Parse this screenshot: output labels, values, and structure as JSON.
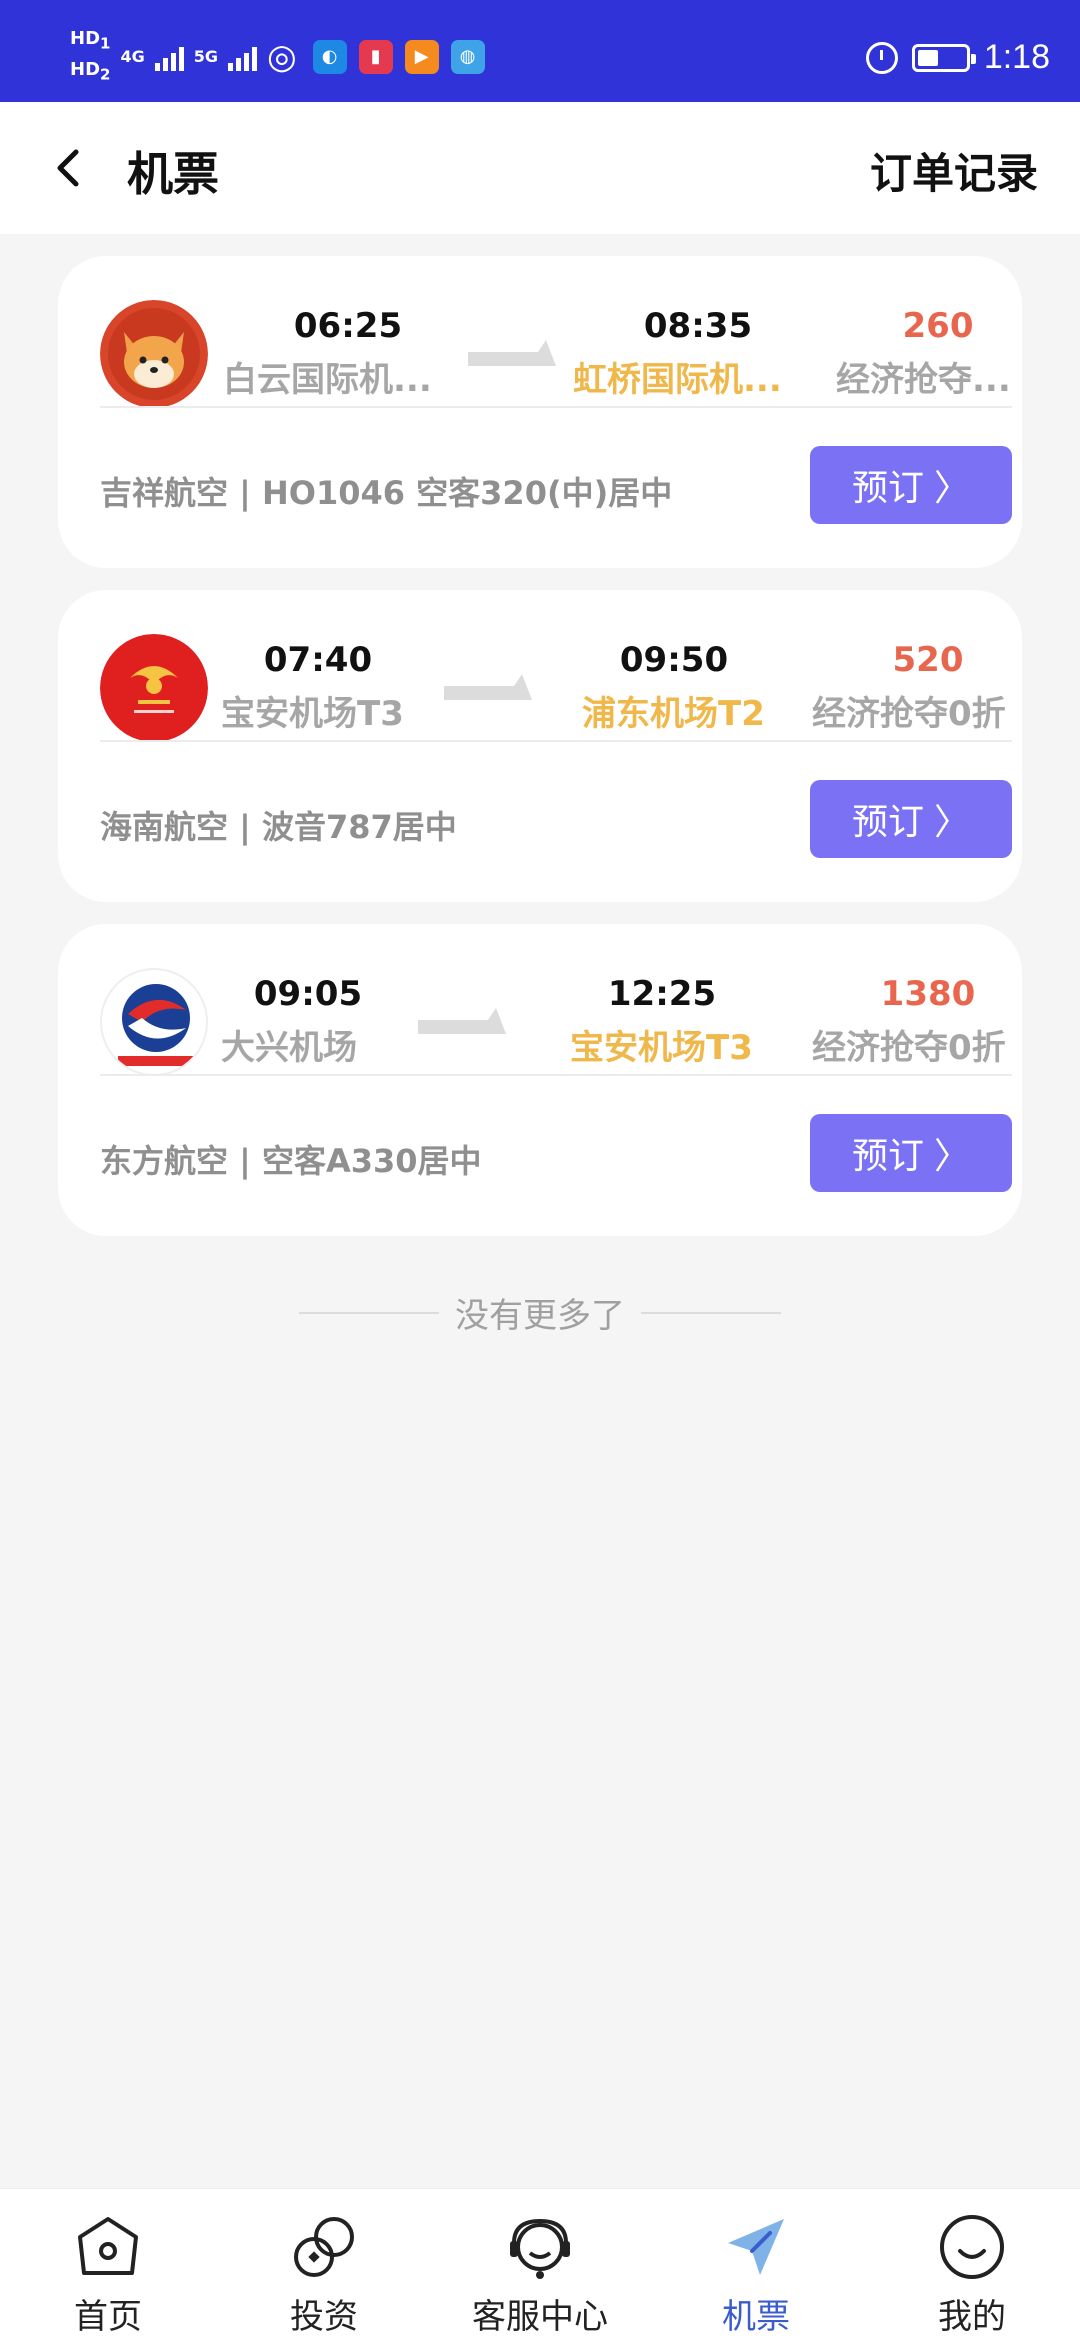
{
  "status_bar": {
    "hd1": "HD",
    "hd1_sub": "1",
    "hd2": "HD",
    "hd2_sub": "2",
    "net1": "4G",
    "net2": "5G",
    "time": "1:18"
  },
  "header": {
    "title": "机票",
    "order_link": "订单记录"
  },
  "flights": [
    {
      "dep_time": "06:25",
      "dep_airport": "白云国际机...",
      "arr_time": "08:35",
      "arr_airport": "虹桥国际机...",
      "price": "260",
      "fare": "经济抢夺...",
      "airline_info": "吉祥航空 | HO1046 空客320(中)居中",
      "book_label": "预订"
    },
    {
      "dep_time": "07:40",
      "dep_airport": "宝安机场T3",
      "arr_time": "09:50",
      "arr_airport": "浦东机场T2",
      "price": "520",
      "fare": "经济抢夺0折",
      "airline_info": "海南航空 | 波音787居中",
      "book_label": "预订"
    },
    {
      "dep_time": "09:05",
      "dep_airport": "大兴机场",
      "arr_time": "12:25",
      "arr_airport": "宝安机场T3",
      "price": "1380",
      "fare": "经济抢夺0折",
      "airline_info": "东方航空 | 空客A330居中",
      "book_label": "预订"
    }
  ],
  "no_more_text": "没有更多了",
  "nav": [
    {
      "label": "首页",
      "icon": "home-icon"
    },
    {
      "label": "投资",
      "icon": "coins-icon"
    },
    {
      "label": "客服中心",
      "icon": "headset-icon"
    },
    {
      "label": "机票",
      "icon": "plane-icon",
      "active": true
    },
    {
      "label": "我的",
      "icon": "profile-icon"
    }
  ],
  "colors": {
    "status_bar": "#2f33d8",
    "book_button": "#7b71f5",
    "price": "#e8664e",
    "arrival": "#f0b74a",
    "nav_active": "#3b5ccf"
  }
}
